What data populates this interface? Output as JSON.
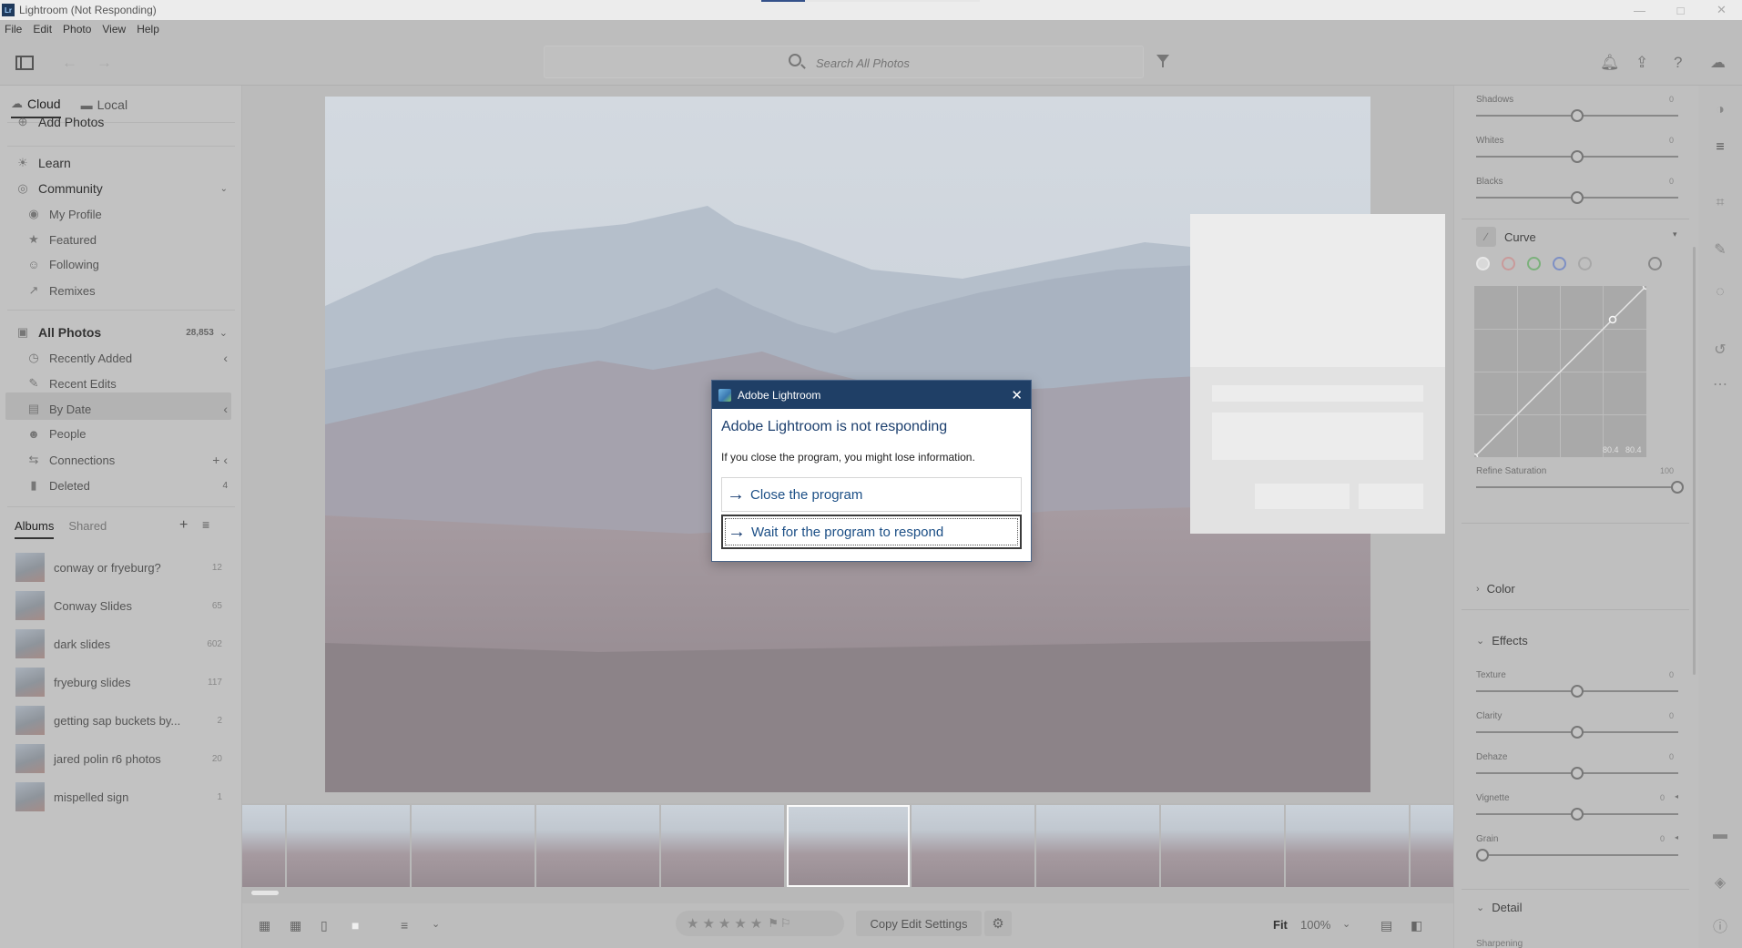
{
  "window": {
    "title": "Lightroom (Not Responding)",
    "logo": "Lr"
  },
  "menu": [
    "File",
    "Edit",
    "Photo",
    "View",
    "Help"
  ],
  "search": {
    "placeholder": "Search All Photos"
  },
  "left_panel": {
    "tabs": [
      {
        "label": "Cloud",
        "icon": "cloud-icon"
      },
      {
        "label": "Local",
        "icon": "folder-icon"
      }
    ],
    "add_photos": "Add Photos",
    "learn": "Learn",
    "community": {
      "label": "Community",
      "items": [
        "My Profile",
        "Featured",
        "Following",
        "Remixes"
      ]
    },
    "all_photos": {
      "label": "All Photos",
      "count": "28,853"
    },
    "library_items": [
      {
        "label": "Recently Added",
        "right": "‹"
      },
      {
        "label": "Recent Edits",
        "right": ""
      },
      {
        "label": "By Date",
        "right": "‹"
      },
      {
        "label": "People",
        "right": ""
      },
      {
        "label": "Connections",
        "right": "+ ‹"
      },
      {
        "label": "Deleted",
        "right": "4"
      }
    ],
    "album_tabs": [
      "Albums",
      "Shared"
    ],
    "albums": [
      {
        "name": "conway or fryeburg?",
        "count": "12"
      },
      {
        "name": "Conway Slides",
        "count": "65"
      },
      {
        "name": "dark slides",
        "count": "602"
      },
      {
        "name": "fryeburg slides",
        "count": "117"
      },
      {
        "name": "getting sap buckets by...",
        "count": "2"
      },
      {
        "name": "jared polin r6 photos",
        "count": "20"
      },
      {
        "name": "mispelled sign",
        "count": "1"
      }
    ]
  },
  "dialog": {
    "title": "Adobe Lightroom",
    "heading": "Adobe Lightroom is not responding",
    "message": "If you close the program, you might lose information.",
    "close_option": "Close the program",
    "wait_option": "Wait for the program to respond"
  },
  "right_panel": {
    "light_sliders": [
      {
        "label": "Shadows",
        "value": "0"
      },
      {
        "label": "Whites",
        "value": "0"
      },
      {
        "label": "Blacks",
        "value": "0"
      }
    ],
    "curve": {
      "label": "Curve",
      "readout_left": "80.4",
      "readout_right": "80.4",
      "refine_saturation": {
        "label": "Refine Saturation",
        "value": "100"
      }
    },
    "color_label": "Color",
    "effects": {
      "label": "Effects",
      "sliders": [
        {
          "label": "Texture",
          "value": "0"
        },
        {
          "label": "Clarity",
          "value": "0"
        },
        {
          "label": "Dehaze",
          "value": "0"
        },
        {
          "label": "Vignette",
          "value": "0"
        },
        {
          "label": "Grain",
          "value": "0"
        }
      ]
    },
    "detail_label": "Detail",
    "detail_partial": "Sharpening"
  },
  "bottom_bar": {
    "copy_edit": "Copy Edit Settings",
    "fit": "Fit",
    "zoom": "100%"
  }
}
